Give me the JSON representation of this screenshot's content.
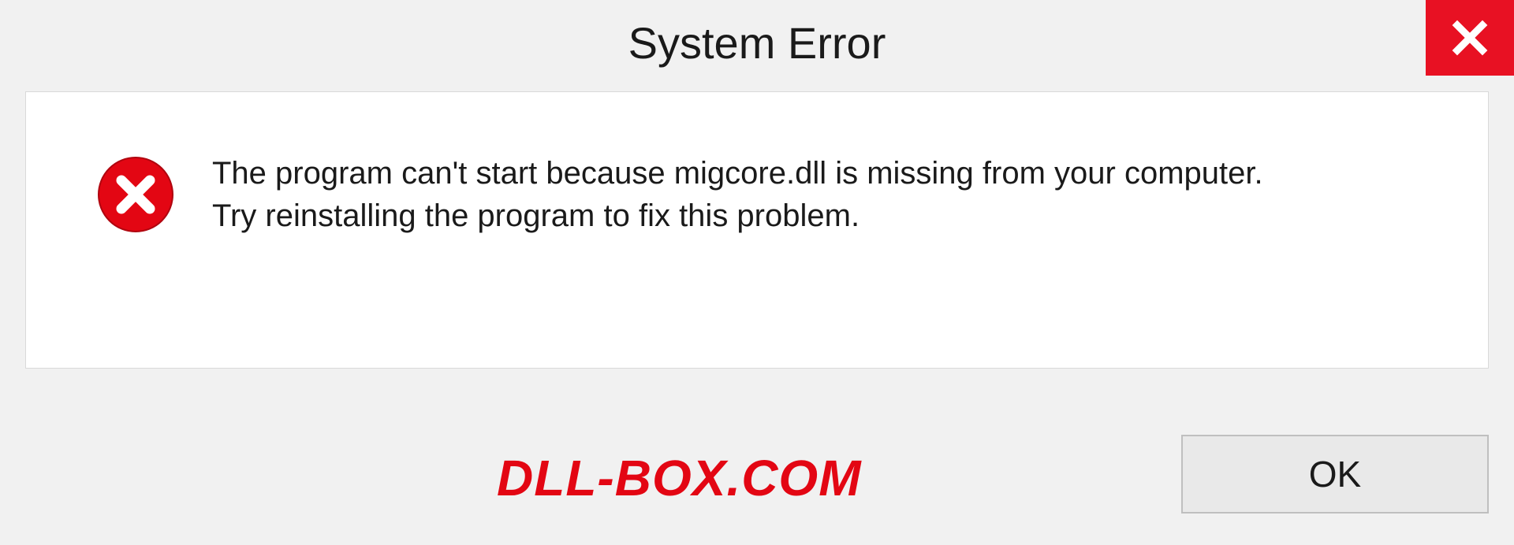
{
  "titlebar": {
    "title": "System Error",
    "close_icon": "close-icon"
  },
  "dialog": {
    "error_icon": "error-circle-x-icon",
    "message_line1": "The program can't start because migcore.dll is missing from your computer.",
    "message_line2": "Try reinstalling the program to fix this problem."
  },
  "footer": {
    "watermark": "DLL-BOX.COM",
    "ok_label": "OK"
  },
  "colors": {
    "close_bg": "#e81123",
    "error_icon": "#e30613",
    "watermark": "#e30613",
    "panel_bg": "#ffffff",
    "page_bg": "#f1f1f1"
  }
}
